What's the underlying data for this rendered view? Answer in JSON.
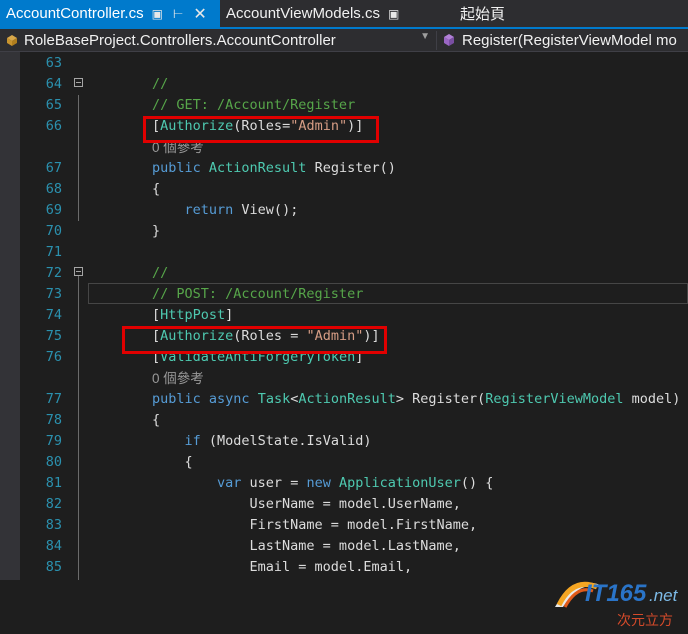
{
  "tabs": [
    {
      "label": "AccountController.cs",
      "pin_icon": "pin-icon",
      "close_icon": "close-icon"
    },
    {
      "label": "AccountViewModels.cs",
      "pin_icon": "pin-icon"
    },
    {
      "label": "起始頁"
    }
  ],
  "nav": {
    "class_dropdown": "RoleBaseProject.Controllers.AccountController",
    "member_dropdown": "Register(RegisterViewModel mo"
  },
  "editor": {
    "reference_text": "0 個參考",
    "lines": [
      {
        "num": "63",
        "tokens": []
      },
      {
        "num": "64",
        "tokens": [
          {
            "t": "//",
            "c": "cm"
          }
        ]
      },
      {
        "num": "65",
        "tokens": [
          {
            "t": "// GET: /Account/Register",
            "c": "cm"
          }
        ]
      },
      {
        "num": "66",
        "tokens": [
          {
            "t": "[",
            "c": "tx"
          },
          {
            "t": "Authorize",
            "c": "ty"
          },
          {
            "t": "(Roles=",
            "c": "tx"
          },
          {
            "t": "\"Admin\"",
            "c": "str"
          },
          {
            "t": ")]",
            "c": "tx"
          }
        ]
      },
      {
        "num": "",
        "ref": true
      },
      {
        "num": "67",
        "tokens": [
          {
            "t": "public ",
            "c": "kw"
          },
          {
            "t": "ActionResult",
            "c": "ty"
          },
          {
            "t": " Register()",
            "c": "tx"
          }
        ]
      },
      {
        "num": "68",
        "tokens": [
          {
            "t": "{",
            "c": "tx"
          }
        ]
      },
      {
        "num": "69",
        "tokens": [
          {
            "t": "    ",
            "c": "tx"
          },
          {
            "t": "return",
            "c": "kw"
          },
          {
            "t": " View();",
            "c": "tx"
          }
        ]
      },
      {
        "num": "70",
        "tokens": [
          {
            "t": "}",
            "c": "tx"
          }
        ]
      },
      {
        "num": "71",
        "tokens": []
      },
      {
        "num": "72",
        "tokens": [
          {
            "t": "//",
            "c": "cm"
          }
        ]
      },
      {
        "num": "73",
        "tokens": [
          {
            "t": "// POST: /Account/Register",
            "c": "cm"
          }
        ]
      },
      {
        "num": "74",
        "tokens": [
          {
            "t": "[",
            "c": "tx"
          },
          {
            "t": "HttpPost",
            "c": "ty"
          },
          {
            "t": "]",
            "c": "tx"
          }
        ]
      },
      {
        "num": "75",
        "tokens": [
          {
            "t": "[",
            "c": "tx"
          },
          {
            "t": "Authorize",
            "c": "ty"
          },
          {
            "t": "(Roles = ",
            "c": "tx"
          },
          {
            "t": "\"Admin\"",
            "c": "str"
          },
          {
            "t": ")]",
            "c": "tx"
          }
        ]
      },
      {
        "num": "76",
        "tokens": [
          {
            "t": "[",
            "c": "tx"
          },
          {
            "t": "ValidateAntiForgeryToken",
            "c": "ty"
          },
          {
            "t": "]",
            "c": "tx"
          }
        ]
      },
      {
        "num": "",
        "ref": true
      },
      {
        "num": "77",
        "tokens": [
          {
            "t": "public ",
            "c": "kw"
          },
          {
            "t": "async ",
            "c": "kw"
          },
          {
            "t": "Task",
            "c": "ty"
          },
          {
            "t": "<",
            "c": "tx"
          },
          {
            "t": "ActionResult",
            "c": "ty"
          },
          {
            "t": "> Register(",
            "c": "tx"
          },
          {
            "t": "RegisterViewModel",
            "c": "ty"
          },
          {
            "t": " model)",
            "c": "tx"
          }
        ]
      },
      {
        "num": "78",
        "tokens": [
          {
            "t": "{",
            "c": "tx"
          }
        ]
      },
      {
        "num": "79",
        "tokens": [
          {
            "t": "    ",
            "c": "tx"
          },
          {
            "t": "if",
            "c": "kw"
          },
          {
            "t": " (ModelState.IsValid)",
            "c": "tx"
          }
        ]
      },
      {
        "num": "80",
        "tokens": [
          {
            "t": "    {",
            "c": "tx"
          }
        ]
      },
      {
        "num": "81",
        "tokens": [
          {
            "t": "        ",
            "c": "tx"
          },
          {
            "t": "var",
            "c": "kw"
          },
          {
            "t": " user = ",
            "c": "tx"
          },
          {
            "t": "new",
            "c": "kw"
          },
          {
            "t": " ",
            "c": "tx"
          },
          {
            "t": "ApplicationUser",
            "c": "ty"
          },
          {
            "t": "() {",
            "c": "tx"
          }
        ]
      },
      {
        "num": "82",
        "tokens": [
          {
            "t": "            UserName = model.UserName,",
            "c": "tx"
          }
        ]
      },
      {
        "num": "83",
        "tokens": [
          {
            "t": "            FirstName = model.FirstName,",
            "c": "tx"
          }
        ]
      },
      {
        "num": "84",
        "tokens": [
          {
            "t": "            LastName = model.LastName,",
            "c": "tx"
          }
        ]
      },
      {
        "num": "85",
        "tokens": [
          {
            "t": "            Email = model.Email,",
            "c": "tx"
          }
        ]
      }
    ]
  },
  "watermark": {
    "brand": "IT165",
    "suffix": ".net",
    "tagline": "次元立方"
  },
  "colors": {
    "accent": "#007acc",
    "highlight_box": "#e10000"
  }
}
